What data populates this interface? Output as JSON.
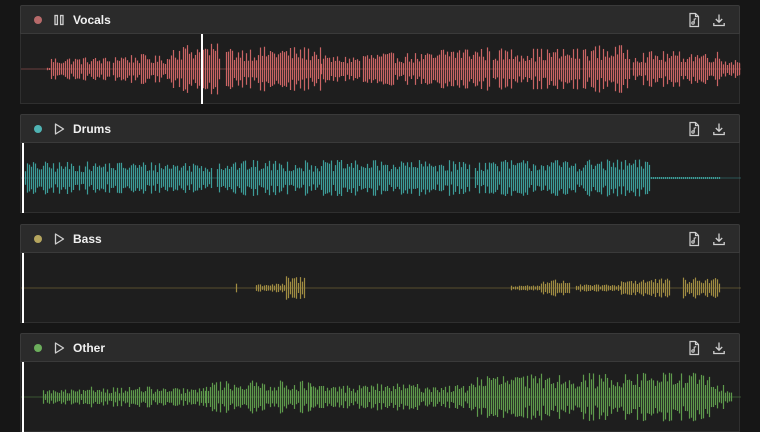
{
  "colors": {
    "background": "#161616",
    "header": "#2b2b2b",
    "wave_bg": "#1e1e1e",
    "playhead": "#ffffff",
    "icon": "#cfcfcf"
  },
  "tracks": [
    {
      "name": "Vocals",
      "color": "#c96464",
      "dot_color": "#b76a6a",
      "state": "playing",
      "play_icon": "pause-icon",
      "playhead": 0.25
    },
    {
      "name": "Drums",
      "color": "#3c9c98",
      "dot_color": "#4fb3b3",
      "state": "stopped",
      "play_icon": "play-icon",
      "playhead": 0
    },
    {
      "name": "Bass",
      "color": "#a08c42",
      "dot_color": "#b5a55e",
      "state": "stopped",
      "play_icon": "play-icon",
      "playhead": 0
    },
    {
      "name": "Other",
      "color": "#5e9a4c",
      "dot_color": "#6cae5c",
      "state": "stopped",
      "play_icon": "play-icon",
      "playhead": 0
    }
  ],
  "icons": {
    "stem": "audio-file-icon",
    "download": "download-icon"
  }
}
